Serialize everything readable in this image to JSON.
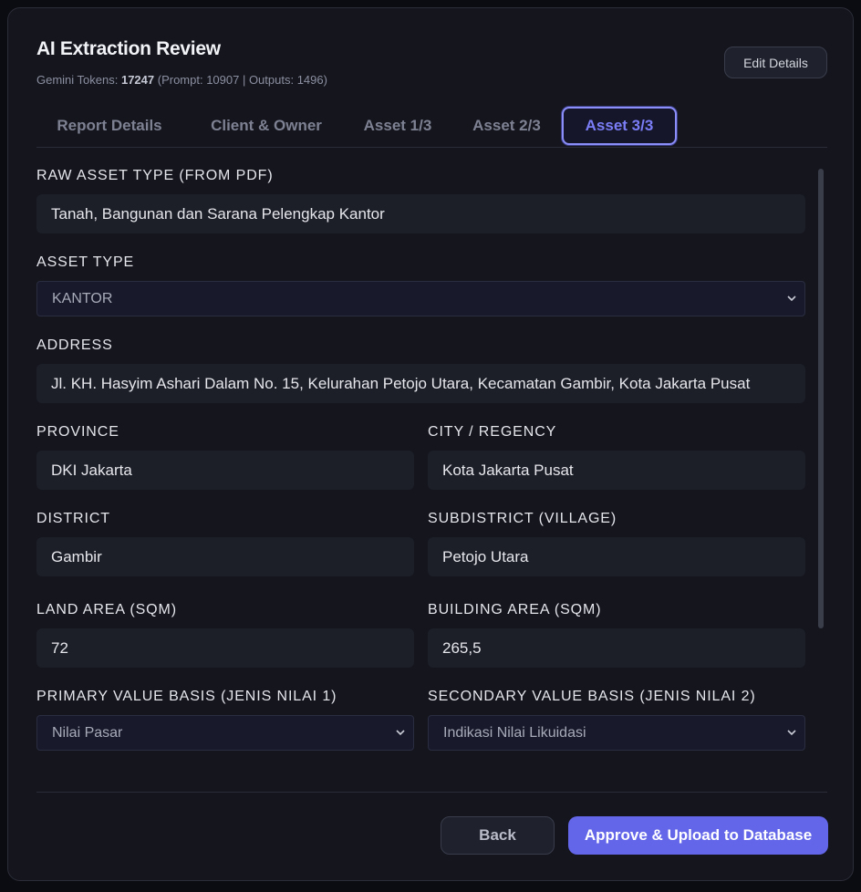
{
  "header": {
    "title": "AI Extraction Review",
    "tokens_label": "Gemini Tokens: ",
    "tokens_total": "17247",
    "tokens_detail": " (Prompt: 10907 | Outputs: 1496)",
    "edit_label": "Edit Details"
  },
  "tabs": [
    {
      "label": "Report Details"
    },
    {
      "label": "Client & Owner"
    },
    {
      "label": "Asset 1/3"
    },
    {
      "label": "Asset 2/3"
    },
    {
      "label": "Asset 3/3",
      "active": true
    }
  ],
  "form": {
    "raw_asset_type": {
      "label": "RAW ASSET TYPE (FROM PDF)",
      "value": "Tanah, Bangunan dan Sarana Pelengkap Kantor"
    },
    "asset_type": {
      "label": "ASSET TYPE",
      "value": "KANTOR"
    },
    "address": {
      "label": "ADDRESS",
      "value": "Jl. KH. Hasyim Ashari Dalam No. 15, Kelurahan Petojo Utara, Kecamatan Gambir, Kota Jakarta Pusat"
    },
    "province": {
      "label": "PROVINCE",
      "value": "DKI Jakarta"
    },
    "city": {
      "label": "CITY / REGENCY",
      "value": "Kota Jakarta Pusat"
    },
    "district": {
      "label": "DISTRICT",
      "value": "Gambir"
    },
    "subdistrict": {
      "label": "SUBDISTRICT (VILLAGE)",
      "value": "Petojo Utara"
    },
    "land_area": {
      "label": "LAND AREA (SQM)",
      "value": "72"
    },
    "building_area": {
      "label": "BUILDING AREA (SQM)",
      "value": "265,5"
    },
    "primary_basis": {
      "label": "PRIMARY VALUE BASIS (JENIS NILAI 1)",
      "value": "Nilai Pasar"
    },
    "secondary_basis": {
      "label": "SECONDARY VALUE BASIS (JENIS NILAI 2)",
      "value": "Indikasi Nilai Likuidasi"
    }
  },
  "footer": {
    "back_label": "Back",
    "approve_label": "Approve & Upload to Database"
  },
  "colors": {
    "accent": "#6366e8",
    "background": "#14151d",
    "input_bg": "#1c1e28"
  }
}
